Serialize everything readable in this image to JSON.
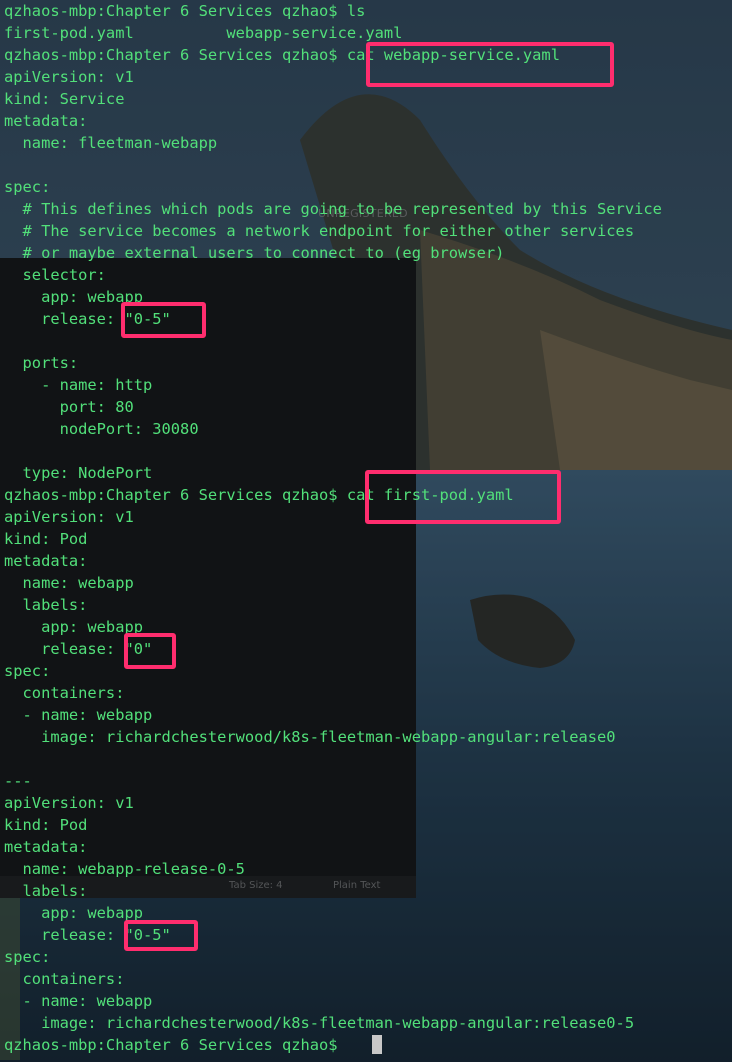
{
  "terminal": {
    "text_color": "#52e07a",
    "lines": [
      "qzhaos-mbp:Chapter 6 Services qzhao$ ls",
      "first-pod.yaml          webapp-service.yaml",
      "qzhaos-mbp:Chapter 6 Services qzhao$ cat webapp-service.yaml",
      "apiVersion: v1",
      "kind: Service",
      "metadata:",
      "  name: fleetman-webapp",
      "",
      "spec:",
      "  # This defines which pods are going to be represented by this Service",
      "  # The service becomes a network endpoint for either other services",
      "  # or maybe external users to connect to (eg browser)",
      "  selector:",
      "    app: webapp",
      "    release: \"0-5\"",
      "",
      "  ports:",
      "    - name: http",
      "      port: 80",
      "      nodePort: 30080",
      "",
      "  type: NodePort",
      "qzhaos-mbp:Chapter 6 Services qzhao$ cat first-pod.yaml",
      "apiVersion: v1",
      "kind: Pod",
      "metadata:",
      "  name: webapp",
      "  labels:",
      "    app: webapp",
      "    release: \"0\"",
      "spec:",
      "  containers:",
      "  - name: webapp",
      "    image: richardchesterwood/k8s-fleetman-webapp-angular:release0",
      "",
      "---",
      "apiVersion: v1",
      "kind: Pod",
      "metadata:",
      "  name: webapp-release-0-5",
      "  labels:",
      "    app: webapp",
      "    release: \"0-5\"",
      "spec:",
      "  containers:",
      "  - name: webapp",
      "    image: richardchesterwood/k8s-fleetman-webapp-angular:release0-5",
      "qzhaos-mbp:Chapter 6 Services qzhao$ "
    ]
  },
  "highlight_color": "#ff2d6e",
  "background_window": {
    "watermark": "UNREGISTERED",
    "tab_size": "Tab Size: 4",
    "syntax": "Plain Text"
  }
}
